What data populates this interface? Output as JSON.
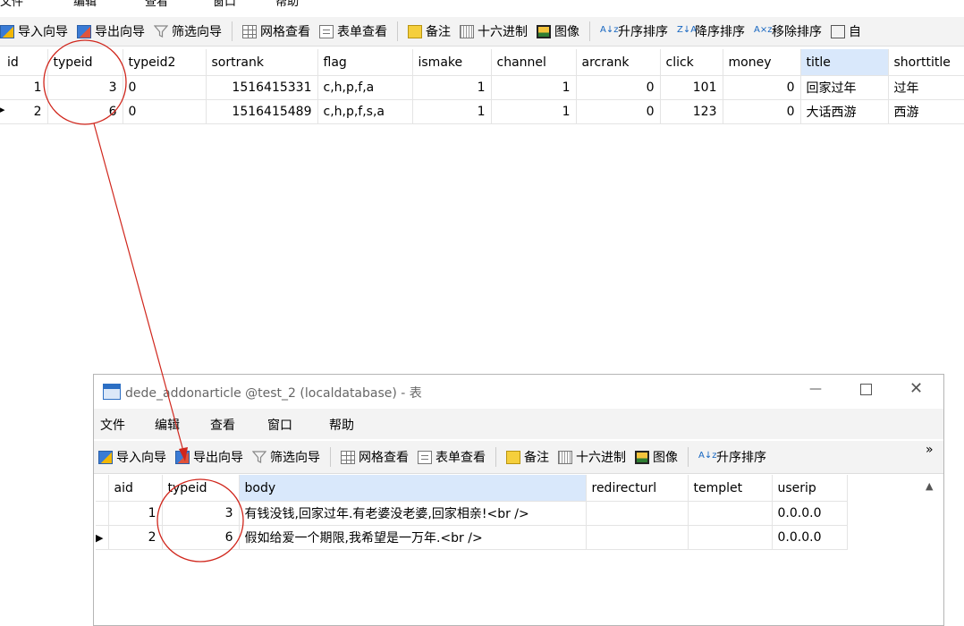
{
  "main": {
    "menu": [
      "文件",
      "编辑",
      "查看",
      "窗口",
      "帮助"
    ],
    "toolbar": [
      "导入向导",
      "导出向导",
      "筛选向导",
      "网格查看",
      "表单查看",
      "备注",
      "十六进制",
      "图像",
      "升序排序",
      "降序排序",
      "移除排序"
    ],
    "toolbar_cut_label": "自",
    "columns": [
      "id",
      "typeid",
      "typeid2",
      "sortrank",
      "flag",
      "ismake",
      "channel",
      "arcrank",
      "click",
      "money",
      "title",
      "shorttitle"
    ],
    "rows": [
      [
        "1",
        "3",
        "0",
        "1516415331",
        "c,h,p,f,a",
        "1",
        "1",
        "0",
        "101",
        "0",
        "回家过年",
        "过年"
      ],
      [
        "2",
        "6",
        "0",
        "1516415489",
        "c,h,p,f,s,a",
        "1",
        "1",
        "0",
        "123",
        "0",
        "大话西游",
        "西游"
      ]
    ]
  },
  "window": {
    "title": "dede_addonarticle @test_2 (localdatabase) - 表",
    "menu": [
      "文件",
      "编辑",
      "查看",
      "窗口",
      "帮助"
    ],
    "toolbar": [
      "导入向导",
      "导出向导",
      "筛选向导",
      "网格查看",
      "表单查看",
      "备注",
      "十六进制",
      "图像",
      "升序排序"
    ],
    "more_glyph": "»",
    "columns": [
      "aid",
      "typeid",
      "body",
      "redirecturl",
      "templet",
      "userip"
    ],
    "rows": [
      [
        "1",
        "3",
        "有钱没钱,回家过年.有老婆没老婆,回家相亲!<br />",
        "",
        "",
        "0.0.0.0"
      ],
      [
        "2",
        "6",
        "假如给爱一个期限,我希望是一万年.<br />",
        "",
        "",
        "0.0.0.0"
      ]
    ]
  },
  "annotation_color": "#d0261c"
}
